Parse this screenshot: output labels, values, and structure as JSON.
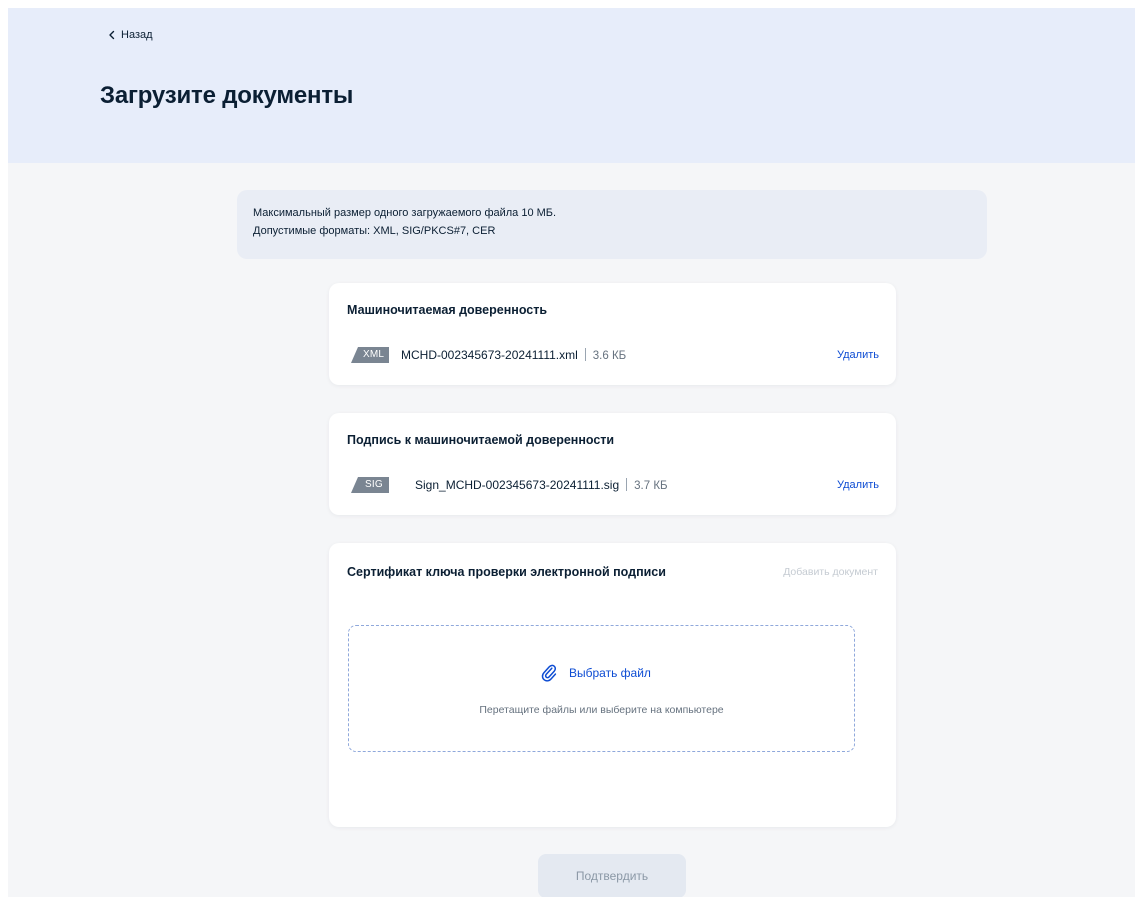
{
  "header": {
    "back_label": "Назад",
    "title": "Загрузите документы"
  },
  "info": {
    "line1": "Максимальный размер одного загружаемого файла 10 МБ.",
    "line2": "Допустимые форматы: XML, SIG/PKCS#7, CER"
  },
  "cards": [
    {
      "title": "Машиночитаемая доверенность",
      "file": {
        "type": "XML",
        "name": "MCHD-002345673-20241111.xml",
        "size": "3.6 КБ",
        "delete_label": "Удалить"
      }
    },
    {
      "title": "Подпись к машиночитаемой доверенности",
      "file": {
        "type": "SIG",
        "name": "Sign_MCHD-002345673-20241111.sig",
        "size": "3.7 КБ",
        "delete_label": "Удалить"
      }
    },
    {
      "title": "Сертификат ключа проверки электронной подписи",
      "add_label": "Добавить документ",
      "upload": {
        "choose_label": "Выбрать файл",
        "hint": "Перетащите файлы или выберите на компьютере",
        "icon": "paperclip-icon"
      }
    }
  ],
  "actions": {
    "confirm_label": "Подтвердить",
    "confirm_disabled": true
  },
  "colors": {
    "hero_bg": "#e7edfa",
    "page_bg": "#f5f6f8",
    "accent": "#0d4cd3",
    "text": "#0b1f33",
    "badge": "#7a8592",
    "disabled_button": "#e4e9f1"
  }
}
